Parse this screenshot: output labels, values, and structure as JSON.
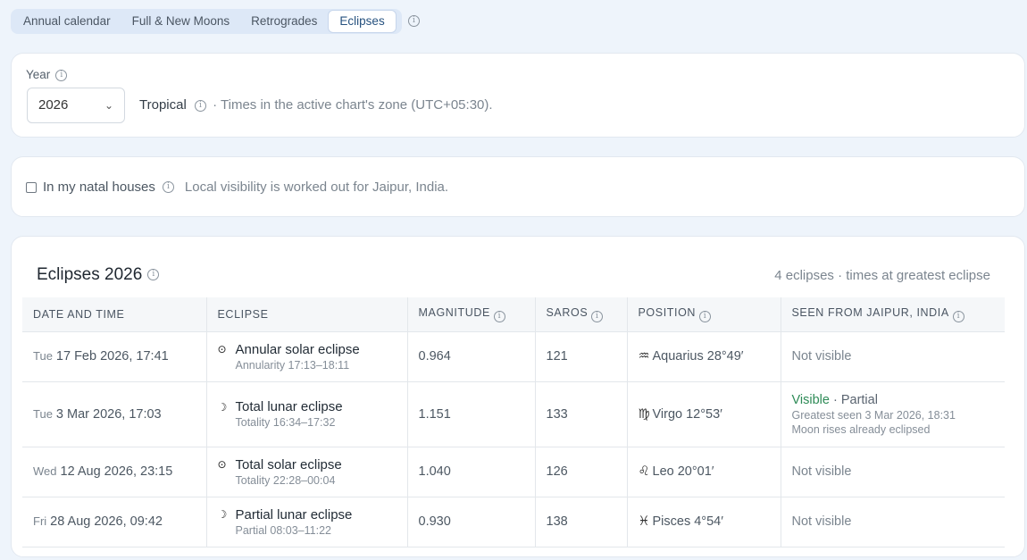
{
  "tabs": [
    {
      "label": "Annual calendar",
      "active": false
    },
    {
      "label": "Full & New Moons",
      "active": false
    },
    {
      "label": "Retrogrades",
      "active": false
    },
    {
      "label": "Eclipses",
      "active": true
    }
  ],
  "year_card": {
    "label": "Year",
    "selected_year": "2026",
    "zodiac": "Tropical",
    "zone_note": "· Times in the active chart's zone (UTC+05:30)."
  },
  "natal": {
    "checkbox_label": "In my natal houses",
    "checked": false,
    "visibility_note": "Local visibility is worked out for Jaipur, India."
  },
  "eclipses": {
    "title": "Eclipses 2026",
    "summary": "4 eclipses · times at greatest eclipse",
    "columns": [
      "DATE AND TIME",
      "ECLIPSE",
      "MAGNITUDE",
      "SAROS",
      "POSITION",
      "SEEN FROM JAIPUR, INDIA"
    ],
    "rows": [
      {
        "dow": "Tue",
        "datetime": "17 Feb 2026, 17:41",
        "symbol": "⊙",
        "name": "Annular solar eclipse",
        "sub": "Annularity 17:13–18:11",
        "magnitude": "0.964",
        "saros": "121",
        "sign_glyph": "♒",
        "position": "Aquarius 28°49′",
        "seen": "Not visible"
      },
      {
        "dow": "Tue",
        "datetime": "3 Mar 2026, 17:03",
        "symbol": "☽",
        "name": "Total lunar eclipse",
        "sub": "Totality 16:34–17:32",
        "magnitude": "1.151",
        "saros": "133",
        "sign_glyph": "♍",
        "position": "Virgo 12°53′",
        "seen_visible": "Visible",
        "seen_partial": "· Partial",
        "seen_line2": "Greatest seen 3 Mar 2026, 18:31",
        "seen_line3": "Moon rises already eclipsed"
      },
      {
        "dow": "Wed",
        "datetime": "12 Aug 2026, 23:15",
        "symbol": "⊙",
        "name": "Total solar eclipse",
        "sub": "Totality 22:28–00:04",
        "magnitude": "1.040",
        "saros": "126",
        "sign_glyph": "♌",
        "position": "Leo 20°01′",
        "seen": "Not visible"
      },
      {
        "dow": "Fri",
        "datetime": "28 Aug 2026, 09:42",
        "symbol": "☽",
        "name": "Partial lunar eclipse",
        "sub": "Partial 08:03–11:22",
        "magnitude": "0.930",
        "saros": "138",
        "sign_glyph": "♓",
        "position": "Pisces 4°54′",
        "seen": "Not visible"
      }
    ]
  }
}
